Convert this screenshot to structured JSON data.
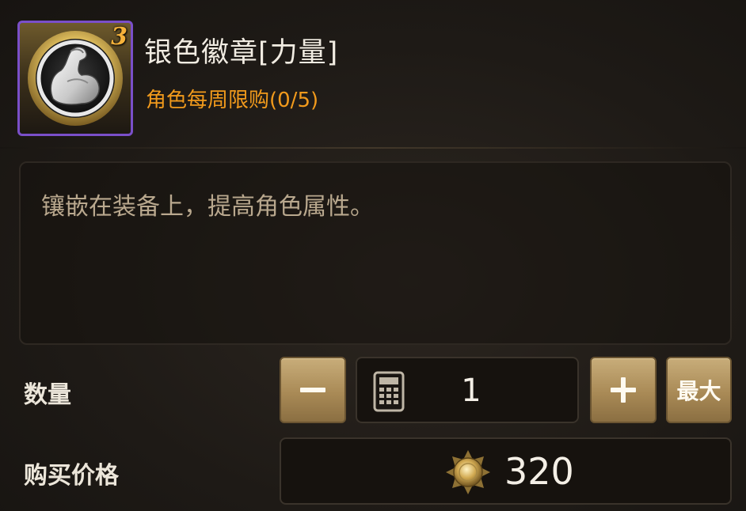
{
  "item": {
    "name": "银色徽章[力量]",
    "count": "3",
    "purchase_limit": "角色每周限购(0/5)",
    "icon": "flexed-arm-icon",
    "frame_color": "#7a4fc9"
  },
  "description": "镶嵌在装备上，提高角色属性。",
  "quantity": {
    "label": "数量",
    "value": "1",
    "decrease_icon": "minus-icon",
    "increase_icon": "plus-icon",
    "calculator_icon": "calculator-icon",
    "max_label": "最大"
  },
  "price": {
    "label": "购买价格",
    "value": "320",
    "currency_icon": "gold-coin-icon"
  },
  "colors": {
    "accent_orange": "#f19a1c",
    "button_gold": "#a98a56",
    "count_gold": "#f6b23a"
  }
}
